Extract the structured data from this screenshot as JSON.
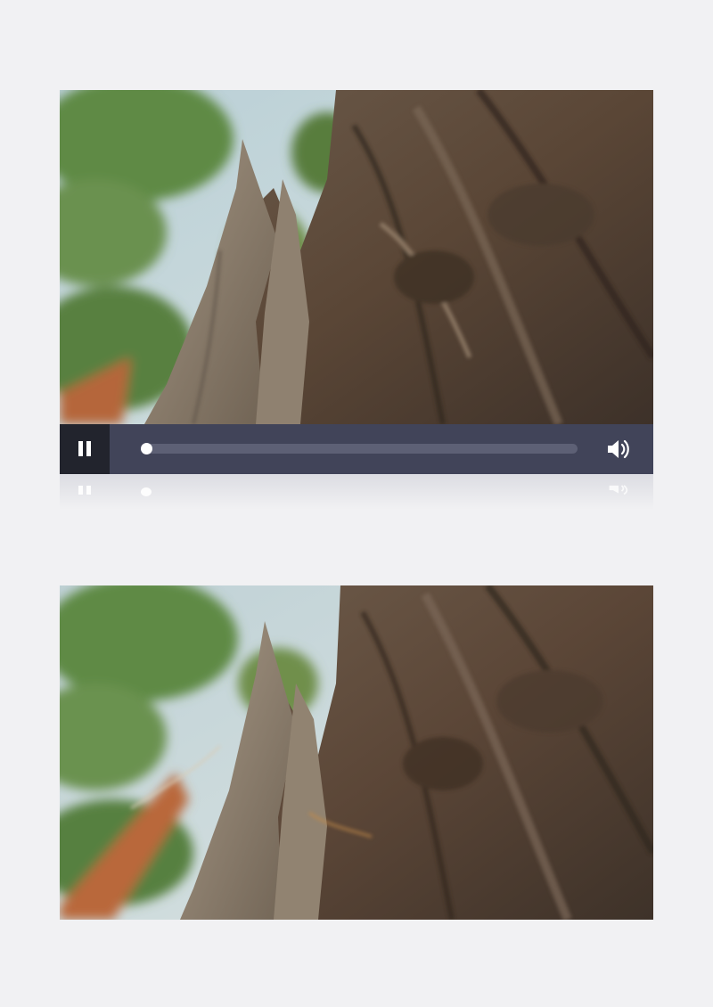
{
  "player": {
    "state": "playing",
    "progress_fraction": 0.0,
    "pause_icon": "pause-icon",
    "volume_icon": "volume-icon"
  },
  "colors": {
    "page_background": "#f1f1f3",
    "control_bar": "#414459",
    "pause_button_bg": "#22242d",
    "progress_track": "#5d6075",
    "knob": "#ffffff"
  }
}
